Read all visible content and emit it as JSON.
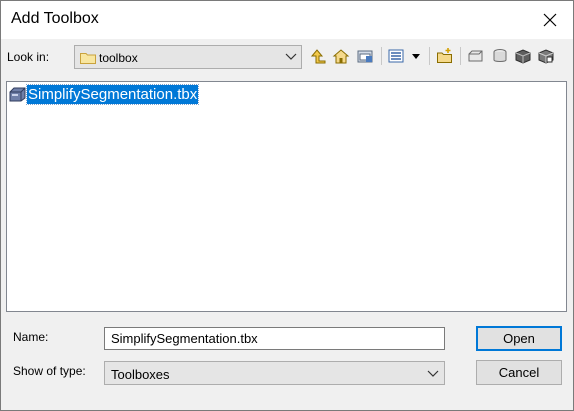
{
  "window": {
    "title": "Add Toolbox"
  },
  "toolbar": {
    "look_in_label": "Look in:",
    "look_in_value": "toolbox",
    "icons": [
      "up-one-level-icon",
      "home-folder-icon",
      "connect-folder-icon",
      "view-menu-icon",
      "new-folder-icon",
      "new-toolbox-icon",
      "database-icon",
      "geodatabase-icon",
      "file-geodatabase-icon"
    ]
  },
  "file_list": {
    "items": [
      {
        "name": "SimplifySegmentation.tbx",
        "icon": "toolbox-icon",
        "selected": true
      }
    ]
  },
  "form": {
    "name_label": "Name:",
    "name_value": "SimplifySegmentation.tbx",
    "type_label": "Show of type:",
    "type_value": "Toolboxes"
  },
  "buttons": {
    "open": "Open",
    "cancel": "Cancel"
  },
  "colors": {
    "selection": "#0078d7",
    "default_button_border": "#0078d7",
    "dialog_bg": "#f0f0f0"
  }
}
